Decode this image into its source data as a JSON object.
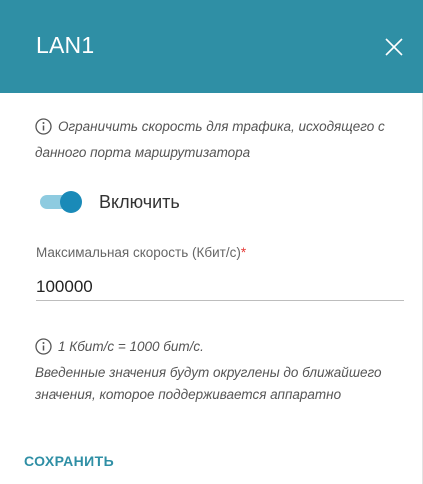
{
  "header": {
    "title": "LAN1",
    "close_icon": "close-icon"
  },
  "info_top": {
    "icon": "info-icon",
    "text": "Ограничить скорость для трафика, исходящего с данного порта маршрутизатора"
  },
  "toggle": {
    "label": "Включить",
    "state": "on"
  },
  "speed_field": {
    "label": "Максимальная скорость (Кбит/с)",
    "required_mark": "*",
    "value": "100000"
  },
  "info_bottom": {
    "icon": "info-icon",
    "line1": "1 Кбит/с = 1000 бит/с.",
    "line2": "Введенные значения будут округлены до ближайшего значения, которое поддерживается аппаратно"
  },
  "actions": {
    "save_label": "СОХРАНИТЬ"
  },
  "colors": {
    "header_bg": "#2f8fa5",
    "accent": "#1a8ab8",
    "required": "#e53935"
  }
}
